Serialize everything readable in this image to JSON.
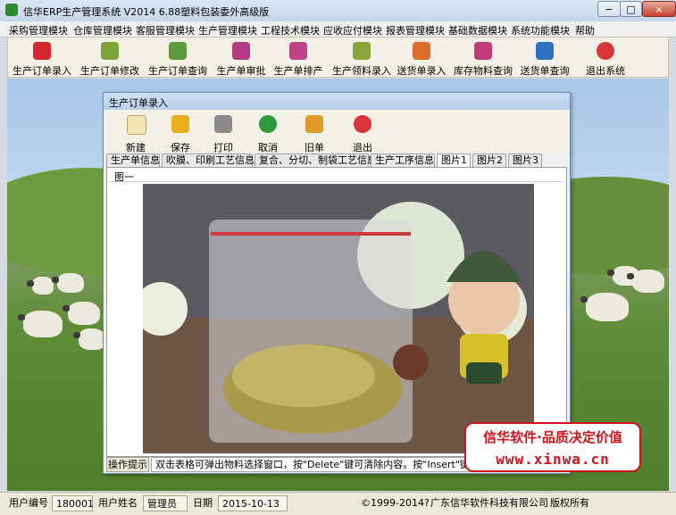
{
  "window": {
    "title": "信华ERP生产管理系统  V2014  6.88塑料包装委外高级版",
    "min_label": "−",
    "max_label": "□",
    "close_label": "×"
  },
  "menu": [
    "采购管理模块",
    "仓库管理模块",
    "客服管理模块",
    "生产管理模块",
    "工程技术模块",
    "应收应付模块",
    "报表管理模块",
    "基础数据模块",
    "系统功能模块",
    "帮助"
  ],
  "toolbar": [
    {
      "label": "生产订单录入",
      "icon": "pdf-icon",
      "color": "#d4272e"
    },
    {
      "label": "生产订单修改",
      "icon": "flower-icon",
      "color": "#7fa23a"
    },
    {
      "label": "生产订单查询",
      "icon": "leaf-icon",
      "color": "#5d9a3a"
    },
    {
      "label": "生产单审批",
      "icon": "flower-icon",
      "color": "#b23a85"
    },
    {
      "label": "生产单排产",
      "icon": "flower-icon",
      "color": "#c2428a"
    },
    {
      "label": "生产领料录入",
      "icon": "flower-icon",
      "color": "#8aa43c"
    },
    {
      "label": "送货单录入",
      "icon": "flower-icon",
      "color": "#e06a2a"
    },
    {
      "label": "库存物料查询",
      "icon": "flower-icon",
      "color": "#c23a7a"
    },
    {
      "label": "送货单查询",
      "icon": "feather-icon",
      "color": "#2f6fc0"
    },
    {
      "label": "退出系统",
      "icon": "power-icon",
      "color": "#d9343a"
    }
  ],
  "child": {
    "title": "生产订单录入",
    "toolbar": [
      {
        "label": "新建",
        "icon": "new-doc-icon",
        "color": "#f1e5b0"
      },
      {
        "label": "保存",
        "icon": "save-icon",
        "color": "#e9b01a"
      },
      {
        "label": "打印",
        "icon": "printer-icon",
        "color": "#8a8a8a"
      },
      {
        "label": "取消",
        "icon": "refresh-icon",
        "color": "#2f9a3a"
      },
      {
        "label": "旧单",
        "icon": "box-icon",
        "color": "#e09a2a"
      },
      {
        "label": "退出",
        "icon": "power-icon",
        "color": "#d9343a"
      }
    ],
    "tabs": [
      "生产单信息",
      "吹膜、印刷工艺信息",
      "复合、分切、制袋工艺信息",
      "生产工序信息",
      "图片1",
      "图片2",
      "图片3"
    ],
    "active_tab": "图片1",
    "panel_title": "图一",
    "ops_label": "操作提示",
    "ops_text": "双击表格可弹出物料选择窗口，按\"Delete\"键可清除内容。按\"Insert\"键可选择插"
  },
  "brand": {
    "line1": "信华软件·品质决定价值",
    "line2": "www.xinwa.cn"
  },
  "status": {
    "user_code_label": "用户编号",
    "user_code": "180001",
    "user_name_label": "用户姓名",
    "user_name": "管理员",
    "date_label": "日期",
    "date": "2015-10-13",
    "copyright": "©1999-2014?",
    "company": "广东信华软件科技有限公司",
    "rights": "版权所有"
  }
}
